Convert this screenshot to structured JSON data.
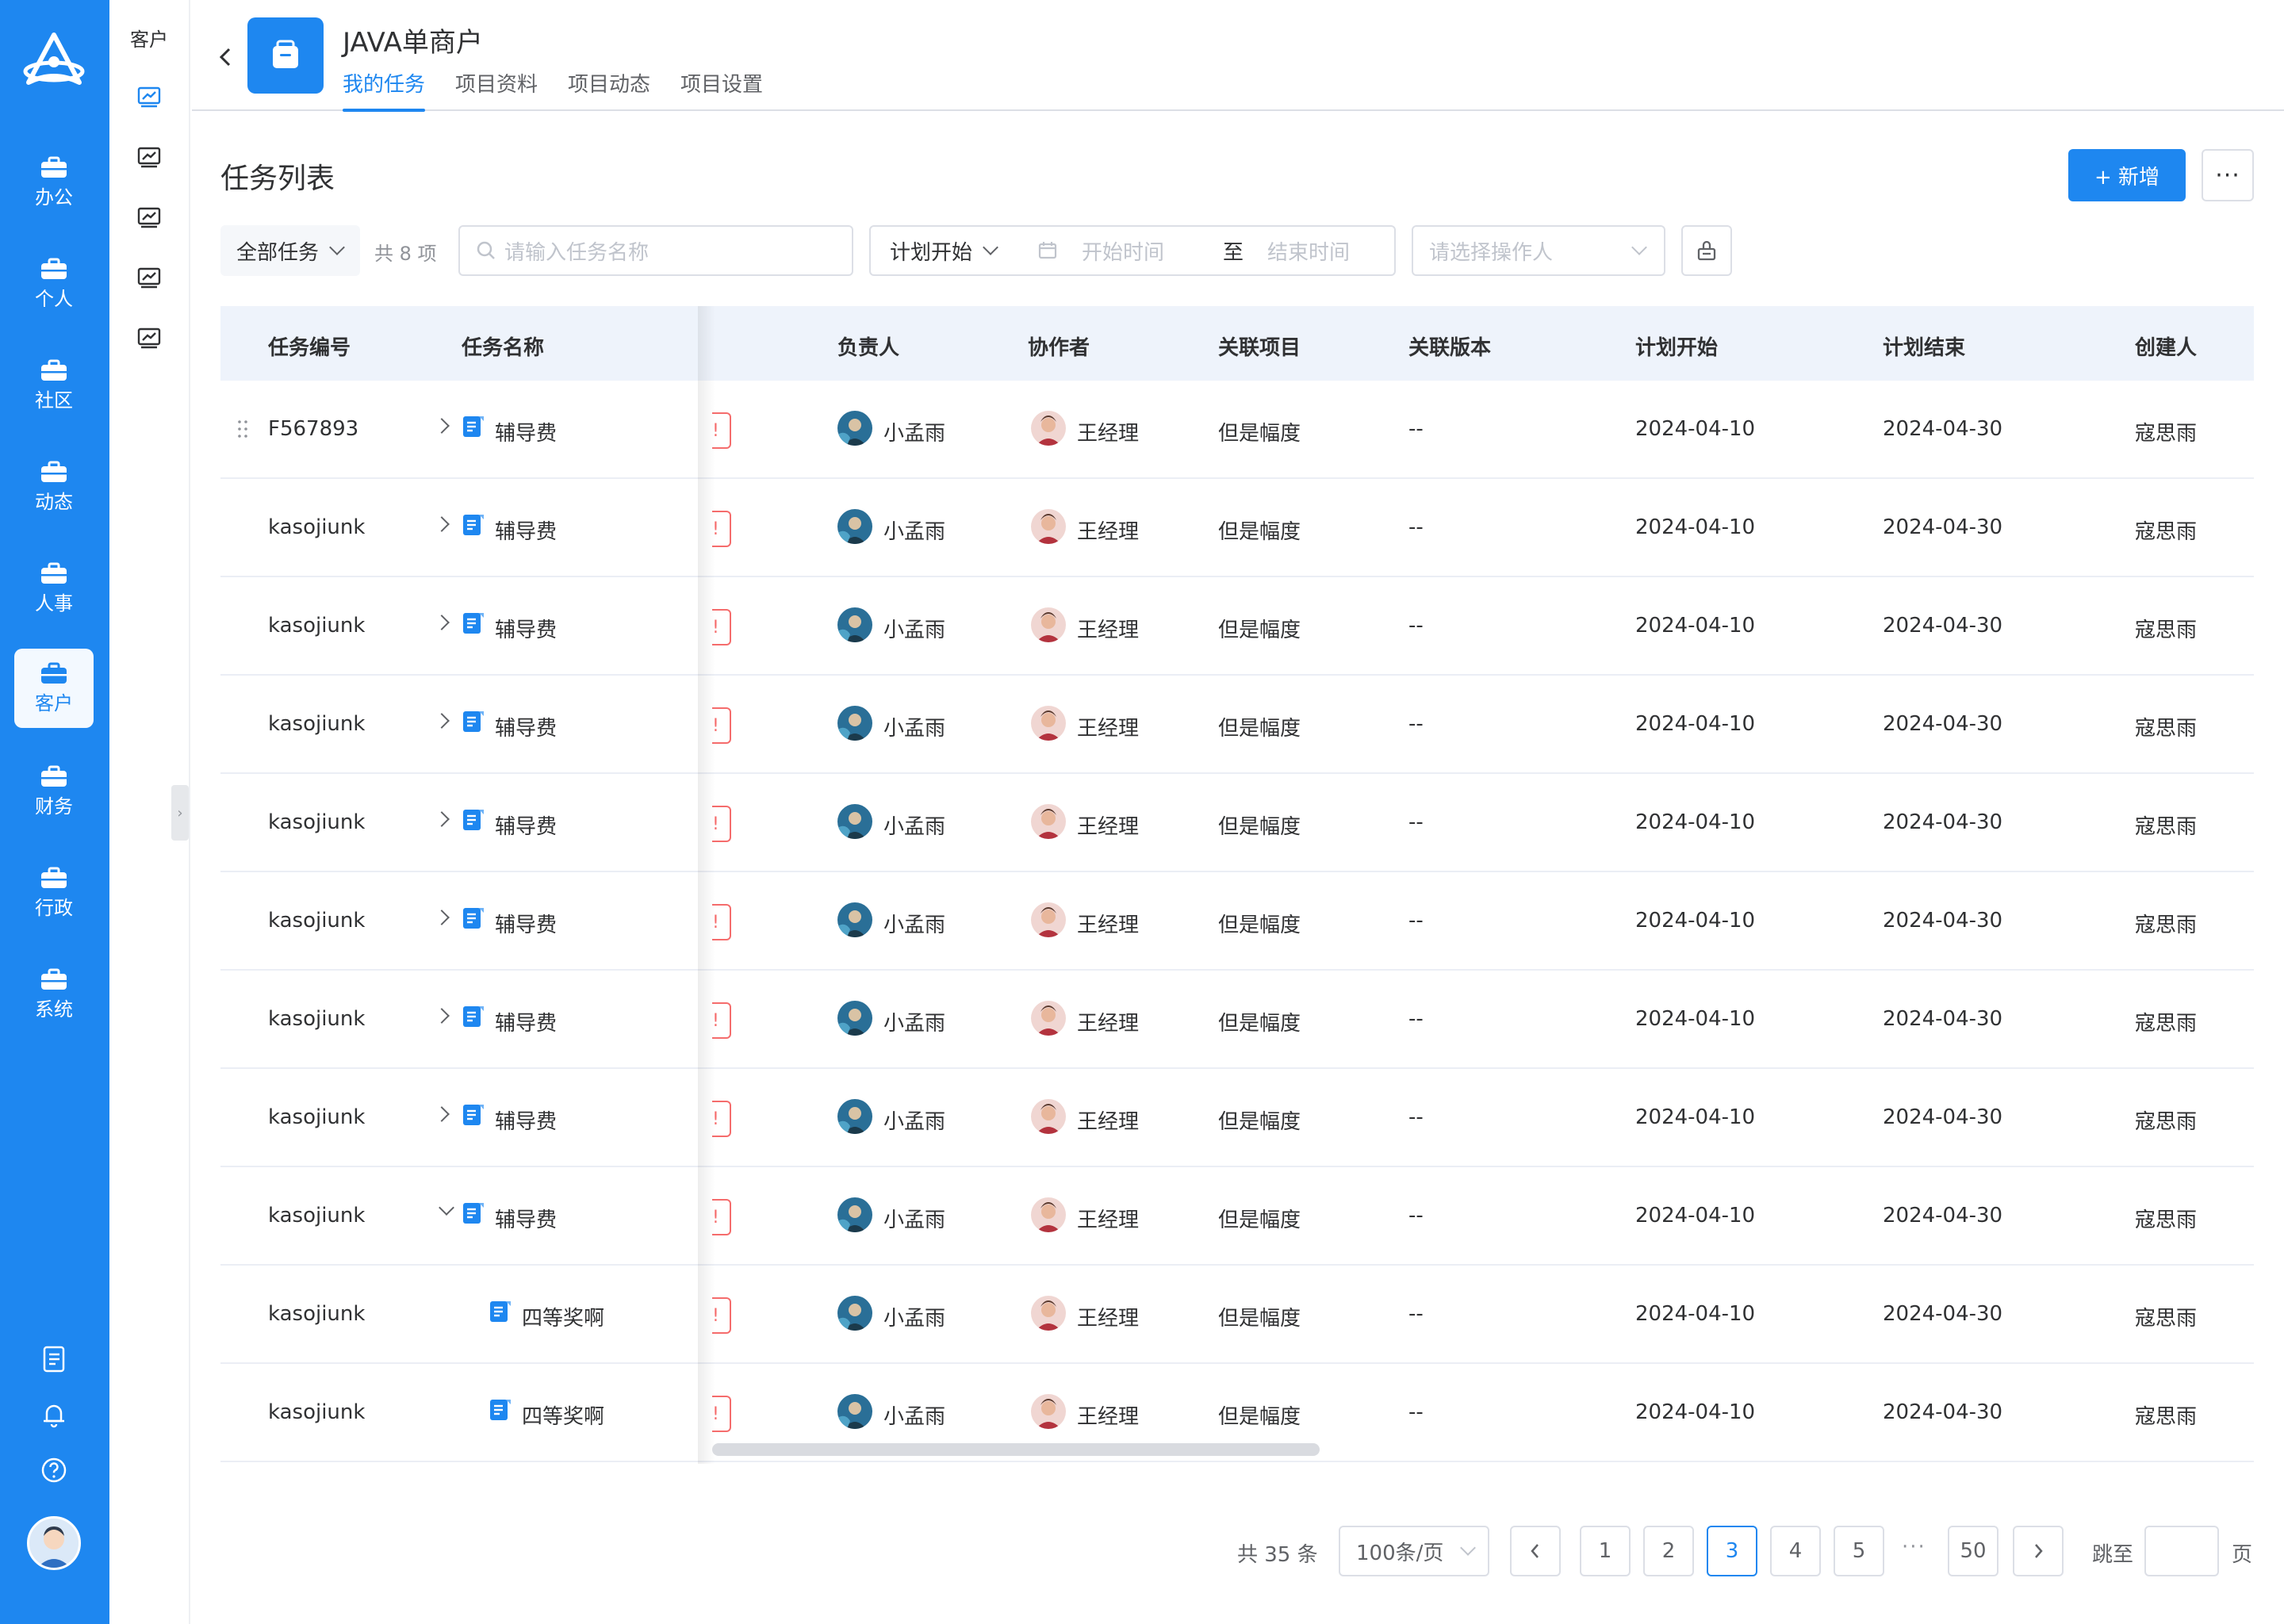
{
  "nav": {
    "items": [
      {
        "label": "办公"
      },
      {
        "label": "个人"
      },
      {
        "label": "社区"
      },
      {
        "label": "动态"
      },
      {
        "label": "人事"
      },
      {
        "label": "客户"
      },
      {
        "label": "财务"
      },
      {
        "label": "行政"
      },
      {
        "label": "系统"
      }
    ],
    "active_index": 5
  },
  "subnav": {
    "title": "客户"
  },
  "header": {
    "title": "JAVA单商户",
    "tabs": [
      {
        "label": "我的任务"
      },
      {
        "label": "项目资料"
      },
      {
        "label": "项目动态"
      },
      {
        "label": "项目设置"
      }
    ],
    "active_tab": 0
  },
  "page": {
    "title": "任务列表",
    "new_button": "+ 新增",
    "more_button": "···"
  },
  "filters": {
    "task_scope": "全部任务",
    "count": "共 8 项",
    "search_placeholder": "请输入任务名称",
    "date_type": "计划开始",
    "start_placeholder": "开始时间",
    "date_sep": "至",
    "end_placeholder": "结束时间",
    "operator_placeholder": "请选择操作人"
  },
  "table": {
    "columns": [
      "任务编号",
      "任务名称",
      "负责人",
      "协作者",
      "关联项目",
      "关联版本",
      "计划开始",
      "计划结束",
      "创建人"
    ],
    "rows": [
      {
        "id": "F567893",
        "name": "辅导费",
        "owner": "小孟雨",
        "collab": "王经理",
        "project": "但是幅度",
        "version": "--",
        "start": "2024-04-10",
        "end": "2024-04-30",
        "creator": "寇思雨",
        "expand": "right",
        "child": false
      },
      {
        "id": "kasojiunk",
        "name": "辅导费",
        "owner": "小孟雨",
        "collab": "王经理",
        "project": "但是幅度",
        "version": "--",
        "start": "2024-04-10",
        "end": "2024-04-30",
        "creator": "寇思雨",
        "expand": "right",
        "child": false
      },
      {
        "id": "kasojiunk",
        "name": "辅导费",
        "owner": "小孟雨",
        "collab": "王经理",
        "project": "但是幅度",
        "version": "--",
        "start": "2024-04-10",
        "end": "2024-04-30",
        "creator": "寇思雨",
        "expand": "right",
        "child": false
      },
      {
        "id": "kasojiunk",
        "name": "辅导费",
        "owner": "小孟雨",
        "collab": "王经理",
        "project": "但是幅度",
        "version": "--",
        "start": "2024-04-10",
        "end": "2024-04-30",
        "creator": "寇思雨",
        "expand": "right",
        "child": false
      },
      {
        "id": "kasojiunk",
        "name": "辅导费",
        "owner": "小孟雨",
        "collab": "王经理",
        "project": "但是幅度",
        "version": "--",
        "start": "2024-04-10",
        "end": "2024-04-30",
        "creator": "寇思雨",
        "expand": "right",
        "child": false
      },
      {
        "id": "kasojiunk",
        "name": "辅导费",
        "owner": "小孟雨",
        "collab": "王经理",
        "project": "但是幅度",
        "version": "--",
        "start": "2024-04-10",
        "end": "2024-04-30",
        "creator": "寇思雨",
        "expand": "right",
        "child": false
      },
      {
        "id": "kasojiunk",
        "name": "辅导费",
        "owner": "小孟雨",
        "collab": "王经理",
        "project": "但是幅度",
        "version": "--",
        "start": "2024-04-10",
        "end": "2024-04-30",
        "creator": "寇思雨",
        "expand": "right",
        "child": false
      },
      {
        "id": "kasojiunk",
        "name": "辅导费",
        "owner": "小孟雨",
        "collab": "王经理",
        "project": "但是幅度",
        "version": "--",
        "start": "2024-04-10",
        "end": "2024-04-30",
        "creator": "寇思雨",
        "expand": "right",
        "child": false
      },
      {
        "id": "kasojiunk",
        "name": "辅导费",
        "owner": "小孟雨",
        "collab": "王经理",
        "project": "但是幅度",
        "version": "--",
        "start": "2024-04-10",
        "end": "2024-04-30",
        "creator": "寇思雨",
        "expand": "down",
        "child": false
      },
      {
        "id": "kasojiunk",
        "name": "四等奖啊",
        "owner": "小孟雨",
        "collab": "王经理",
        "project": "但是幅度",
        "version": "--",
        "start": "2024-04-10",
        "end": "2024-04-30",
        "creator": "寇思雨",
        "expand": "none",
        "child": true
      },
      {
        "id": "kasojiunk",
        "name": "四等奖啊",
        "owner": "小孟雨",
        "collab": "王经理",
        "project": "但是幅度",
        "version": "--",
        "start": "2024-04-10",
        "end": "2024-04-30",
        "creator": "寇思雨",
        "expand": "none",
        "child": true
      }
    ],
    "warn_mark": "!"
  },
  "pagination": {
    "total": "共 35 条",
    "page_size": "100条/页",
    "pages": [
      "1",
      "2",
      "3",
      "4",
      "5"
    ],
    "current": "3",
    "ellipsis": "···",
    "last": "50",
    "jump_label": "跳至",
    "unit": "页"
  },
  "colors": {
    "primary": "#1e87f0",
    "warn": "#f56c6c",
    "header_bg": "#eef3fb"
  },
  "icons": {
    "nav": "briefcase-icon",
    "subnav": "chart-board-icon",
    "bottom": [
      "task-list-icon",
      "bell-icon",
      "help-icon"
    ]
  }
}
